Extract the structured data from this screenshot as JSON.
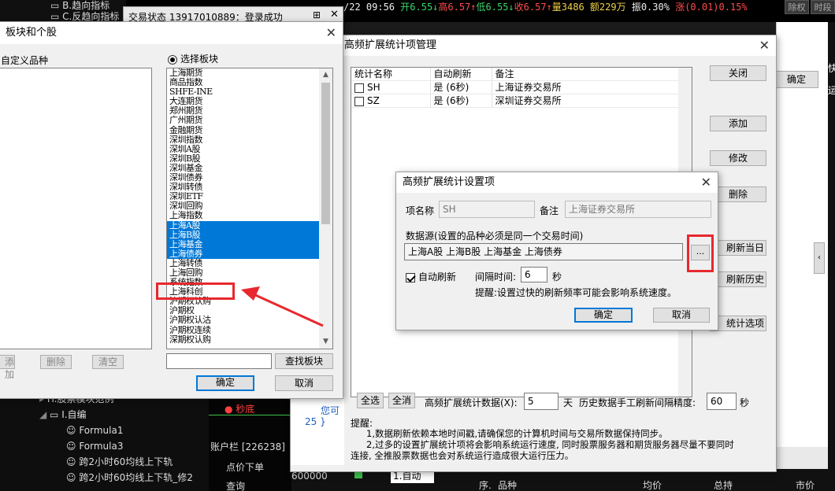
{
  "bg": {
    "tree_item1": "B.趋向指标",
    "tree_item2": "C.反趋向指标",
    "ticker": {
      "date": "/22 09:56",
      "open": "开6.55↓",
      "high": "高6.57↑",
      "low": "低6.55↓",
      "close": "收6.57↑",
      "vol": "量3486",
      "amount": "额229万",
      "amp": "振0.30%",
      "chg": "涨(0.01)0.15%"
    },
    "right_btns": [
      "除权",
      "时段"
    ],
    "bottom_tree": [
      "H.股票模块范例",
      "I.自编",
      "Formula1",
      "Formula3",
      "跨2小时60均线上下轨",
      "跨2小时60均线上下轨_修2"
    ],
    "sec_label": "秒底",
    "acct_label": "账户栏 [226238]",
    "order_label": "点价下单",
    "query_label": "查询",
    "footer_code": "600000",
    "footer_auto": "1.自动",
    "footer_cols": [
      "序.",
      "品种",
      "均价",
      "总持",
      "市价"
    ],
    "code_lines": [
      "您可",
      "25 }"
    ],
    "right_labels": [
      "快",
      "运"
    ],
    "behind_ok": "确定"
  },
  "trade_status": {
    "title": "交易状态 13917010889：登录成功"
  },
  "sector_dialog": {
    "title": "板块和个股",
    "left_label": "自定义品种",
    "radio_label": "选择板块",
    "items": [
      "上海期货",
      "商品指数",
      "SHFE-INE",
      "大连期货",
      "郑州期货",
      "广州期货",
      "金融期货",
      "深圳指数",
      "深圳A股",
      "深圳B股",
      "深圳基金",
      "深圳债券",
      "深圳转债",
      "深圳ETF",
      "深圳回购",
      "上海指数",
      "上海A股",
      "上海B股",
      "上海基金",
      "上海债券",
      "上海转债",
      "上海回购",
      "系统指数",
      "上海科创",
      "沪期权认购",
      "沪期权",
      "沪期权认沽",
      "沪期权连续",
      "深期权认购"
    ],
    "selected": [
      16,
      17,
      18,
      19
    ],
    "highlight_index": 23,
    "add_label": "添加",
    "delete_label": "删除",
    "clear_label": "清空",
    "search_label": "查找板块",
    "ok_label": "确定",
    "cancel_label": "取消"
  },
  "mgr_dialog": {
    "title": "高频扩展统计项管理",
    "headers": [
      "统计名称",
      "自动刷新",
      "备注"
    ],
    "rows": [
      {
        "name": "SH",
        "auto": "是 (6秒)",
        "note": "上海证券交易所"
      },
      {
        "name": "SZ",
        "auto": "是 (6秒)",
        "note": "深圳证券交易所"
      }
    ],
    "btn_close": "关闭",
    "btn_add": "添加",
    "btn_edit": "修改",
    "btn_delete": "删除",
    "btn_refresh_today": "刷新当日",
    "btn_refresh_hist": "刷新历史",
    "btn_options": "统计选项",
    "select_all": "全选",
    "clear_all": "全消",
    "count_label": "高频扩展统计数据(X):",
    "count_value": "5",
    "days_label": "天",
    "hist_label": "历史数据手工刷新间隔精度:",
    "hist_value": "60",
    "sec_label": "秒",
    "tips_title": "提醒:",
    "tips_line1": "1,数据刷新依赖本地时间戳,请确保您的计算机时间与交易所数据保持同步。",
    "tips_line2": "2,过多的设置扩展统计项将会影响系统运行速度, 同时股票服务器和期货服务器尽量不要同时",
    "tips_line3": "连接, 全推股票数据也会对系统运行造成很大运行压力。"
  },
  "setting_dialog": {
    "title": "高频扩展统计设置项",
    "name_label": "项名称",
    "name_value": "SH",
    "note_label": "备注",
    "note_value": "上海证券交易所",
    "source_label": "数据源(设置的品种必须是同一个交易时间)",
    "source_value": "上海A股  上海B股  上海基金  上海债券",
    "browse_label": "...",
    "auto_label": "自动刷新",
    "interval_label": "间隔时间:",
    "interval_value": "6",
    "sec_label": "秒",
    "tip": "提醒:设置过快的刷新频率可能会影响系统速度。",
    "ok_label": "确定",
    "cancel_label": "取消"
  }
}
